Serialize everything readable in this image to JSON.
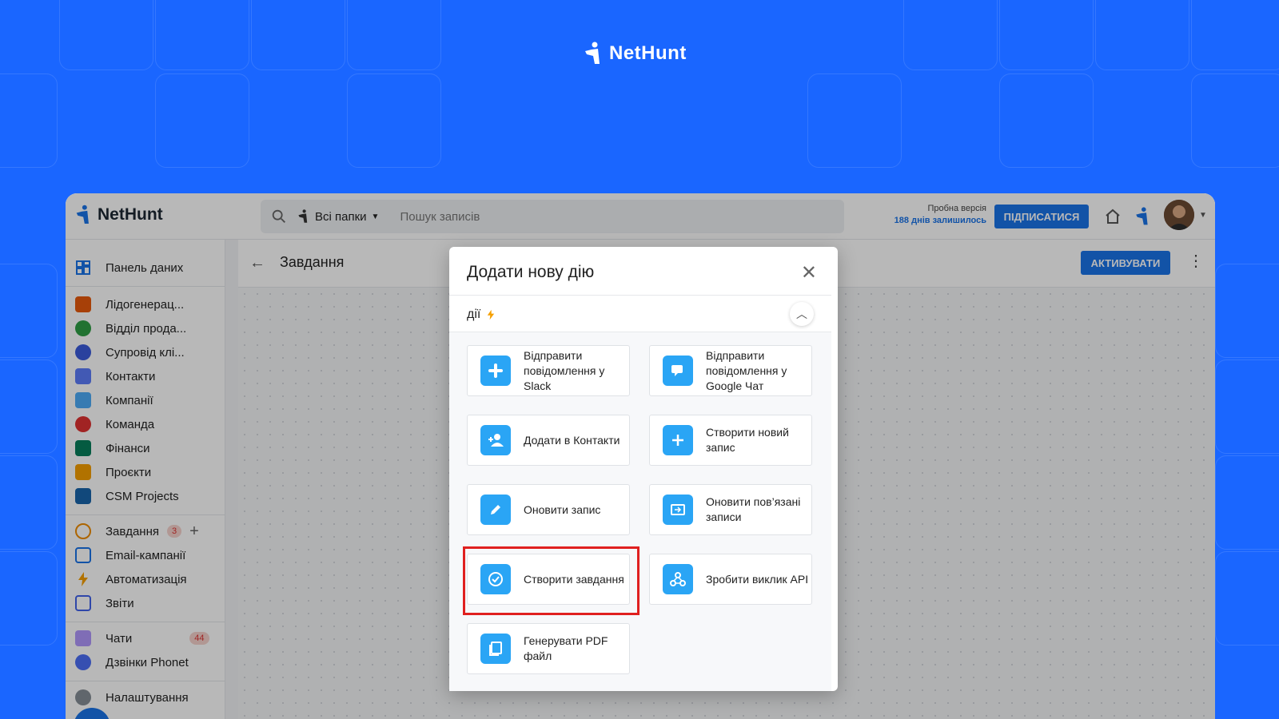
{
  "brand": {
    "name": "NetHunt"
  },
  "app_logo": {
    "name": "NetHunt"
  },
  "topbar": {
    "folder_label": "Всі папки",
    "search_placeholder": "Пошук записів",
    "trial_label": "Пробна версія",
    "trial_days": "188 днів залишилось",
    "subscribe_label": "ПІДПИСАТИСЯ"
  },
  "sidebar": {
    "dashboard": "Панель даних",
    "items": [
      {
        "label": "Лідогенерац...",
        "icon": "file-icon",
        "color": "#e8590c"
      },
      {
        "label": "Відділ прода...",
        "icon": "dollar-icon",
        "color": "#2f9e44"
      },
      {
        "label": "Супровід клі...",
        "icon": "bolt-circle-icon",
        "color": "#3b5bdb"
      },
      {
        "label": "Контакти",
        "icon": "people-icon",
        "color": "#5c7cfa"
      },
      {
        "label": "Компанії",
        "icon": "building-icon",
        "color": "#4dabf7"
      },
      {
        "label": "Команда",
        "icon": "smile-icon",
        "color": "#e03131"
      },
      {
        "label": "Фінанси",
        "icon": "wallet-icon",
        "color": "#087f5b"
      },
      {
        "label": "Проєкти",
        "icon": "star-folder-icon",
        "color": "#f59f00"
      },
      {
        "label": "CSM Projects",
        "icon": "clipboard-icon",
        "color": "#1864ab"
      }
    ],
    "tools": [
      {
        "label": "Завдання",
        "icon": "task-icon",
        "badge": "3"
      },
      {
        "label": "Email-кампанії",
        "icon": "mail-icon"
      },
      {
        "label": "Автоматизація",
        "icon": "bolt-icon"
      },
      {
        "label": "Звіти",
        "icon": "chart-icon"
      }
    ],
    "chats": {
      "label": "Чати",
      "badge": "44"
    },
    "calls": {
      "label": "Дзвінки Phonet"
    },
    "settings": {
      "label": "Налаштування"
    }
  },
  "main": {
    "title": "Завдання",
    "activate_label": "АКТИВУВАТИ"
  },
  "modal": {
    "title": "Додати нову дію",
    "section_label": "дії",
    "actions": [
      {
        "label": "Відправити повідомлення у Slack",
        "icon": "slack-icon"
      },
      {
        "label": "Відправити повідомлення у Google Чат",
        "icon": "google-chat-icon"
      },
      {
        "label": "Додати в Контакти",
        "icon": "add-person-icon"
      },
      {
        "label": "Створити новий запис",
        "icon": "plus-icon"
      },
      {
        "label": "Оновити запис",
        "icon": "pencil-icon"
      },
      {
        "label": "Оновити пов’язані записи",
        "icon": "linked-records-icon"
      },
      {
        "label": "Створити завдання",
        "icon": "check-circle-icon"
      },
      {
        "label": "Зробити виклик API",
        "icon": "webhook-icon"
      },
      {
        "label": "Генерувати PDF файл",
        "icon": "pdf-icon"
      }
    ]
  },
  "colors": {
    "background": "#1a66ff",
    "accent": "#1a73e8",
    "action_icon": "#2aa5f5",
    "highlight": "#e0201f"
  }
}
